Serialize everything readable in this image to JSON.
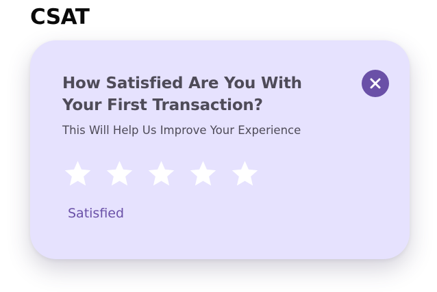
{
  "heading": "CSAT",
  "card": {
    "title": "How Satisfied Are You With Your First Transaction?",
    "subtitle": "This Will Help Us Improve Your Experience",
    "close_icon": "close-icon",
    "rating": {
      "max": 5,
      "selected": 0,
      "label": "Satisfied"
    }
  },
  "colors": {
    "card_background": "#e6e2fe",
    "accent": "#6a50a7",
    "text": "#4e4b58",
    "star": "#ffffff"
  }
}
